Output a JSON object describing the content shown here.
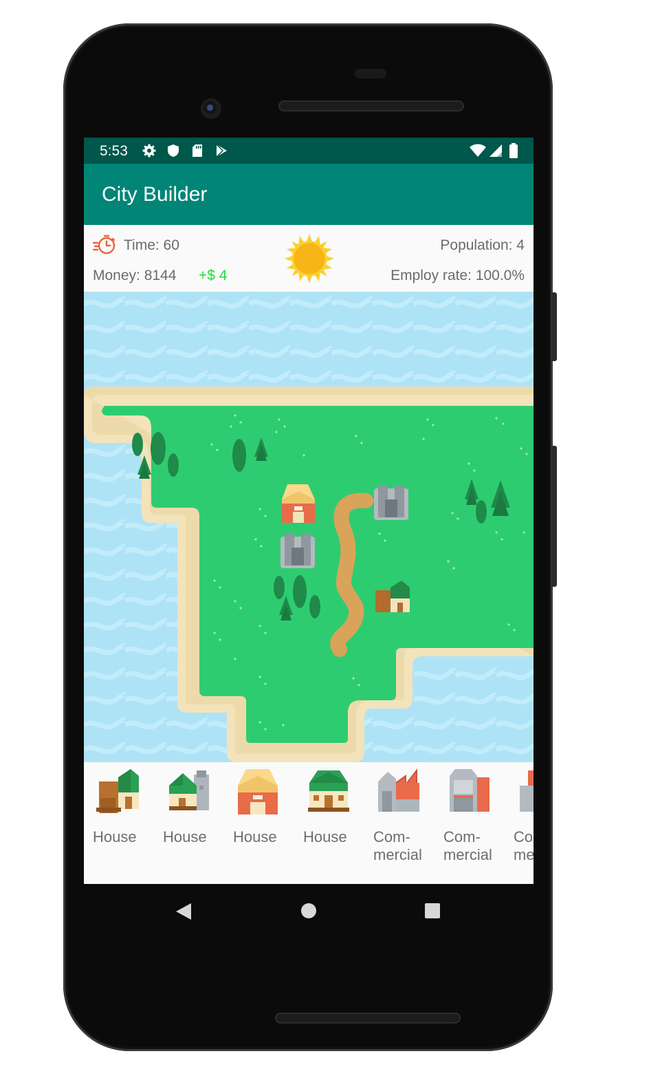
{
  "status_bar": {
    "time": "5:53",
    "icons": [
      "gear-icon",
      "shield-icon",
      "sd-card-icon",
      "play-store-icon"
    ],
    "right_icons": [
      "wifi-icon",
      "signal-icon",
      "battery-icon"
    ]
  },
  "app_bar": {
    "title": "City Builder"
  },
  "stats": {
    "time_label": "Time: 60",
    "money_label": "Money: 8144",
    "money_delta": "+$ 4",
    "population_label": "Population: 4",
    "employ_label": "Employ rate: 100.0%",
    "weather_icon": "sun-icon"
  },
  "palette": {
    "items": [
      {
        "label": "House",
        "icon": "house-wood-icon"
      },
      {
        "label": "House",
        "icon": "house-silo-icon"
      },
      {
        "label": "House",
        "icon": "house-yellow-roof-icon"
      },
      {
        "label": "House",
        "icon": "house-green-roof-icon"
      },
      {
        "label": "Com-\nmercial",
        "icon": "commercial-factory-icon"
      },
      {
        "label": "Com-\nmercial",
        "icon": "commercial-garage-icon"
      },
      {
        "label": "Com-\nmercial",
        "icon": "commercial-tower-icon"
      }
    ]
  },
  "colors": {
    "status_bar": "#00574b",
    "app_bar": "#008577",
    "water": "#aee3f6",
    "grass": "#2ecc71",
    "sand": "#f3e3bb",
    "money_delta": "#1fdc3a"
  }
}
